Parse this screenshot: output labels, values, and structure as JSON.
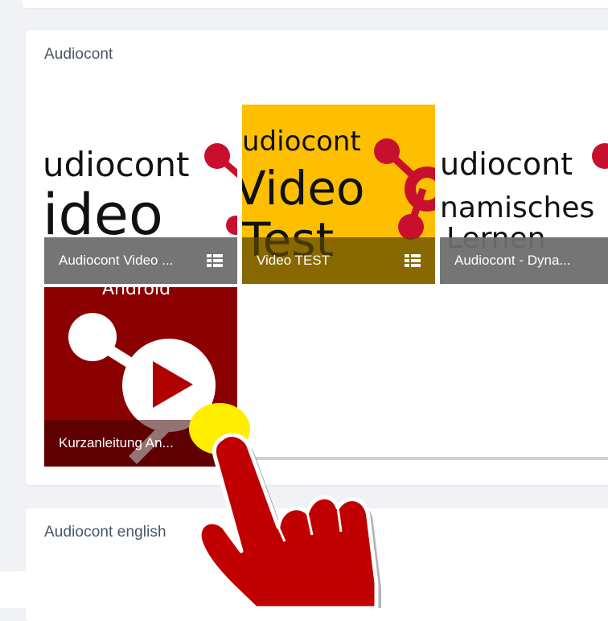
{
  "sections": [
    {
      "title": "Audiocont",
      "tiles": [
        {
          "thumb_line1": "udiocont",
          "thumb_line2": "ideo",
          "caption": "Audiocont Video ...",
          "icon": "grid-list-icon"
        },
        {
          "thumb_line1": "udiocont",
          "thumb_line2": "Video",
          "thumb_line3": "Test",
          "caption": "Video TEST",
          "icon": "grid-list-icon"
        },
        {
          "thumb_line1": "udiocont",
          "thumb_line2": "namisches",
          "thumb_line3": "Lernen",
          "caption": "Audiocont - Dyna...",
          "icon": "grid-list-icon"
        },
        {
          "thumb_line1": "Android",
          "caption": "Kurzanleitung An...",
          "icon": "play-logo-icon"
        }
      ]
    },
    {
      "title": "Audiocont english"
    }
  ],
  "overlay": {
    "icon": "pointing-hand-icon",
    "highlight_color": "#ffee00",
    "hand_color": "#c00000"
  },
  "colors": {
    "brand_red": "#c8102e",
    "tile_yellow": "#fdbf00",
    "tile_darkred": "#8b0000"
  }
}
